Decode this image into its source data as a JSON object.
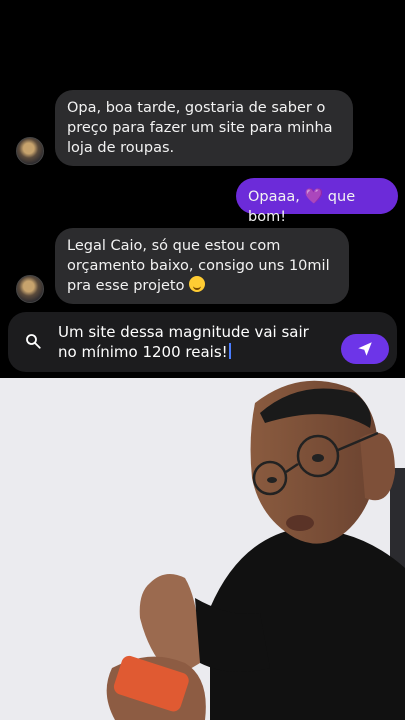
{
  "messages": [
    {
      "from": "contact",
      "text": "Opa, boa tarde, gostaria de saber o preço para fazer um site para minha loja de roupas."
    },
    {
      "from": "me",
      "text_before": "Opaaa, ",
      "emoji": "💜",
      "text_after": " que bom!"
    },
    {
      "from": "contact",
      "text": "Legal Caio, só que estou com orçamento baixo, consigo uns 10mil pra esse projeto",
      "emoji": "smiling-sweat-emoji"
    }
  ],
  "composer": {
    "text": "Um site dessa magnitude vai sair no mínimo 1200 reais!",
    "search_icon": "search-icon",
    "send_icon": "send-icon",
    "send_color": "#6d35e8"
  },
  "colors": {
    "background": "#000000",
    "incoming_bubble": "#2c2c2e",
    "outgoing_bubble": "#6c2bd9"
  },
  "photo": {
    "subject": "reaction-photo-person-with-glasses-holding-phone"
  }
}
